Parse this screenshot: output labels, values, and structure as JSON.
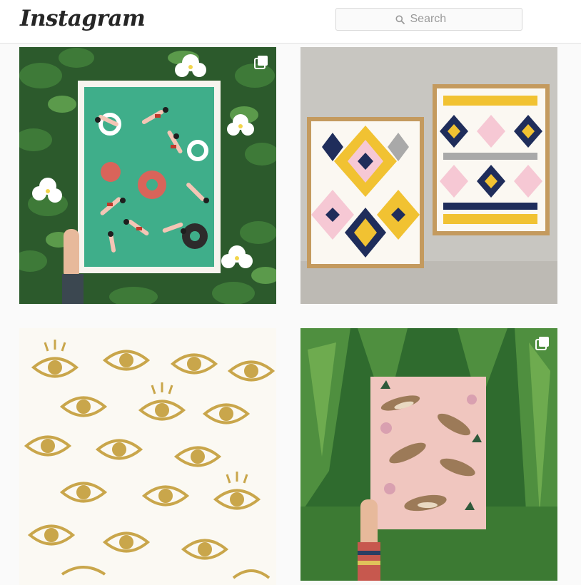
{
  "header": {
    "logo_text": "Instagram",
    "search": {
      "placeholder": "Search"
    }
  },
  "posts": [
    {
      "subject": "swimmers-poster",
      "multi_image": true
    },
    {
      "subject": "geometric-prints",
      "multi_image": false
    },
    {
      "subject": "gold-eyes-pattern",
      "multi_image": false
    },
    {
      "subject": "otters-poster",
      "multi_image": true
    }
  ],
  "colors": {
    "header_bg": "#ffffff",
    "page_bg": "#fafafa",
    "logo": "#262626",
    "placeholder": "#9a9a9a"
  }
}
